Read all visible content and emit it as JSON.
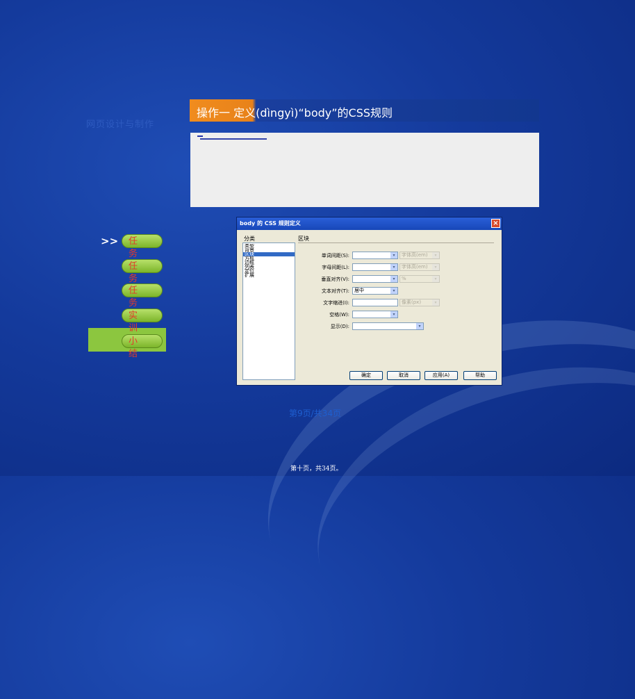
{
  "slide": {
    "faded_title": "网页设计与制作",
    "operation_title": "操作一   定义(dìngyì)“body”的CSS规则",
    "page_indicator": "第9页/共34页",
    "footer": "第十页，共34页。"
  },
  "nav": {
    "arrow": ">>",
    "items": [
      {
        "label": "任务一"
      },
      {
        "label": "任务二"
      },
      {
        "label": "任务三"
      },
      {
        "label": "实训"
      },
      {
        "label": "小结"
      }
    ]
  },
  "dialog": {
    "title": "body 的 CSS 规则定义",
    "close": "×",
    "category_label": "分类",
    "section_label": "区块",
    "categories": [
      "类型",
      "背景",
      "区块",
      "方框",
      "边框",
      "列表",
      "定位",
      "扩展"
    ],
    "selected_category": "区块",
    "fields": {
      "word_spacing": {
        "label": "单词间距(S):",
        "value": "",
        "unit": "字体高(em)"
      },
      "letter_spacing": {
        "label": "字母间距(L):",
        "value": "",
        "unit": "字体高(em)"
      },
      "vertical_align": {
        "label": "垂直对齐(V):",
        "value": "",
        "unit": "%"
      },
      "text_align": {
        "label": "文本对齐(T):",
        "value": "居中"
      },
      "text_indent": {
        "label": "文字缩进(I):",
        "value": "",
        "unit": "像素(px)"
      },
      "whitespace": {
        "label": "空格(W):",
        "value": ""
      },
      "display": {
        "label": "显示(D):",
        "value": ""
      }
    },
    "buttons": {
      "ok": "确定",
      "cancel": "取消",
      "apply": "应用(A)",
      "help": "帮助"
    },
    "dropdown_glyph": "▾"
  }
}
